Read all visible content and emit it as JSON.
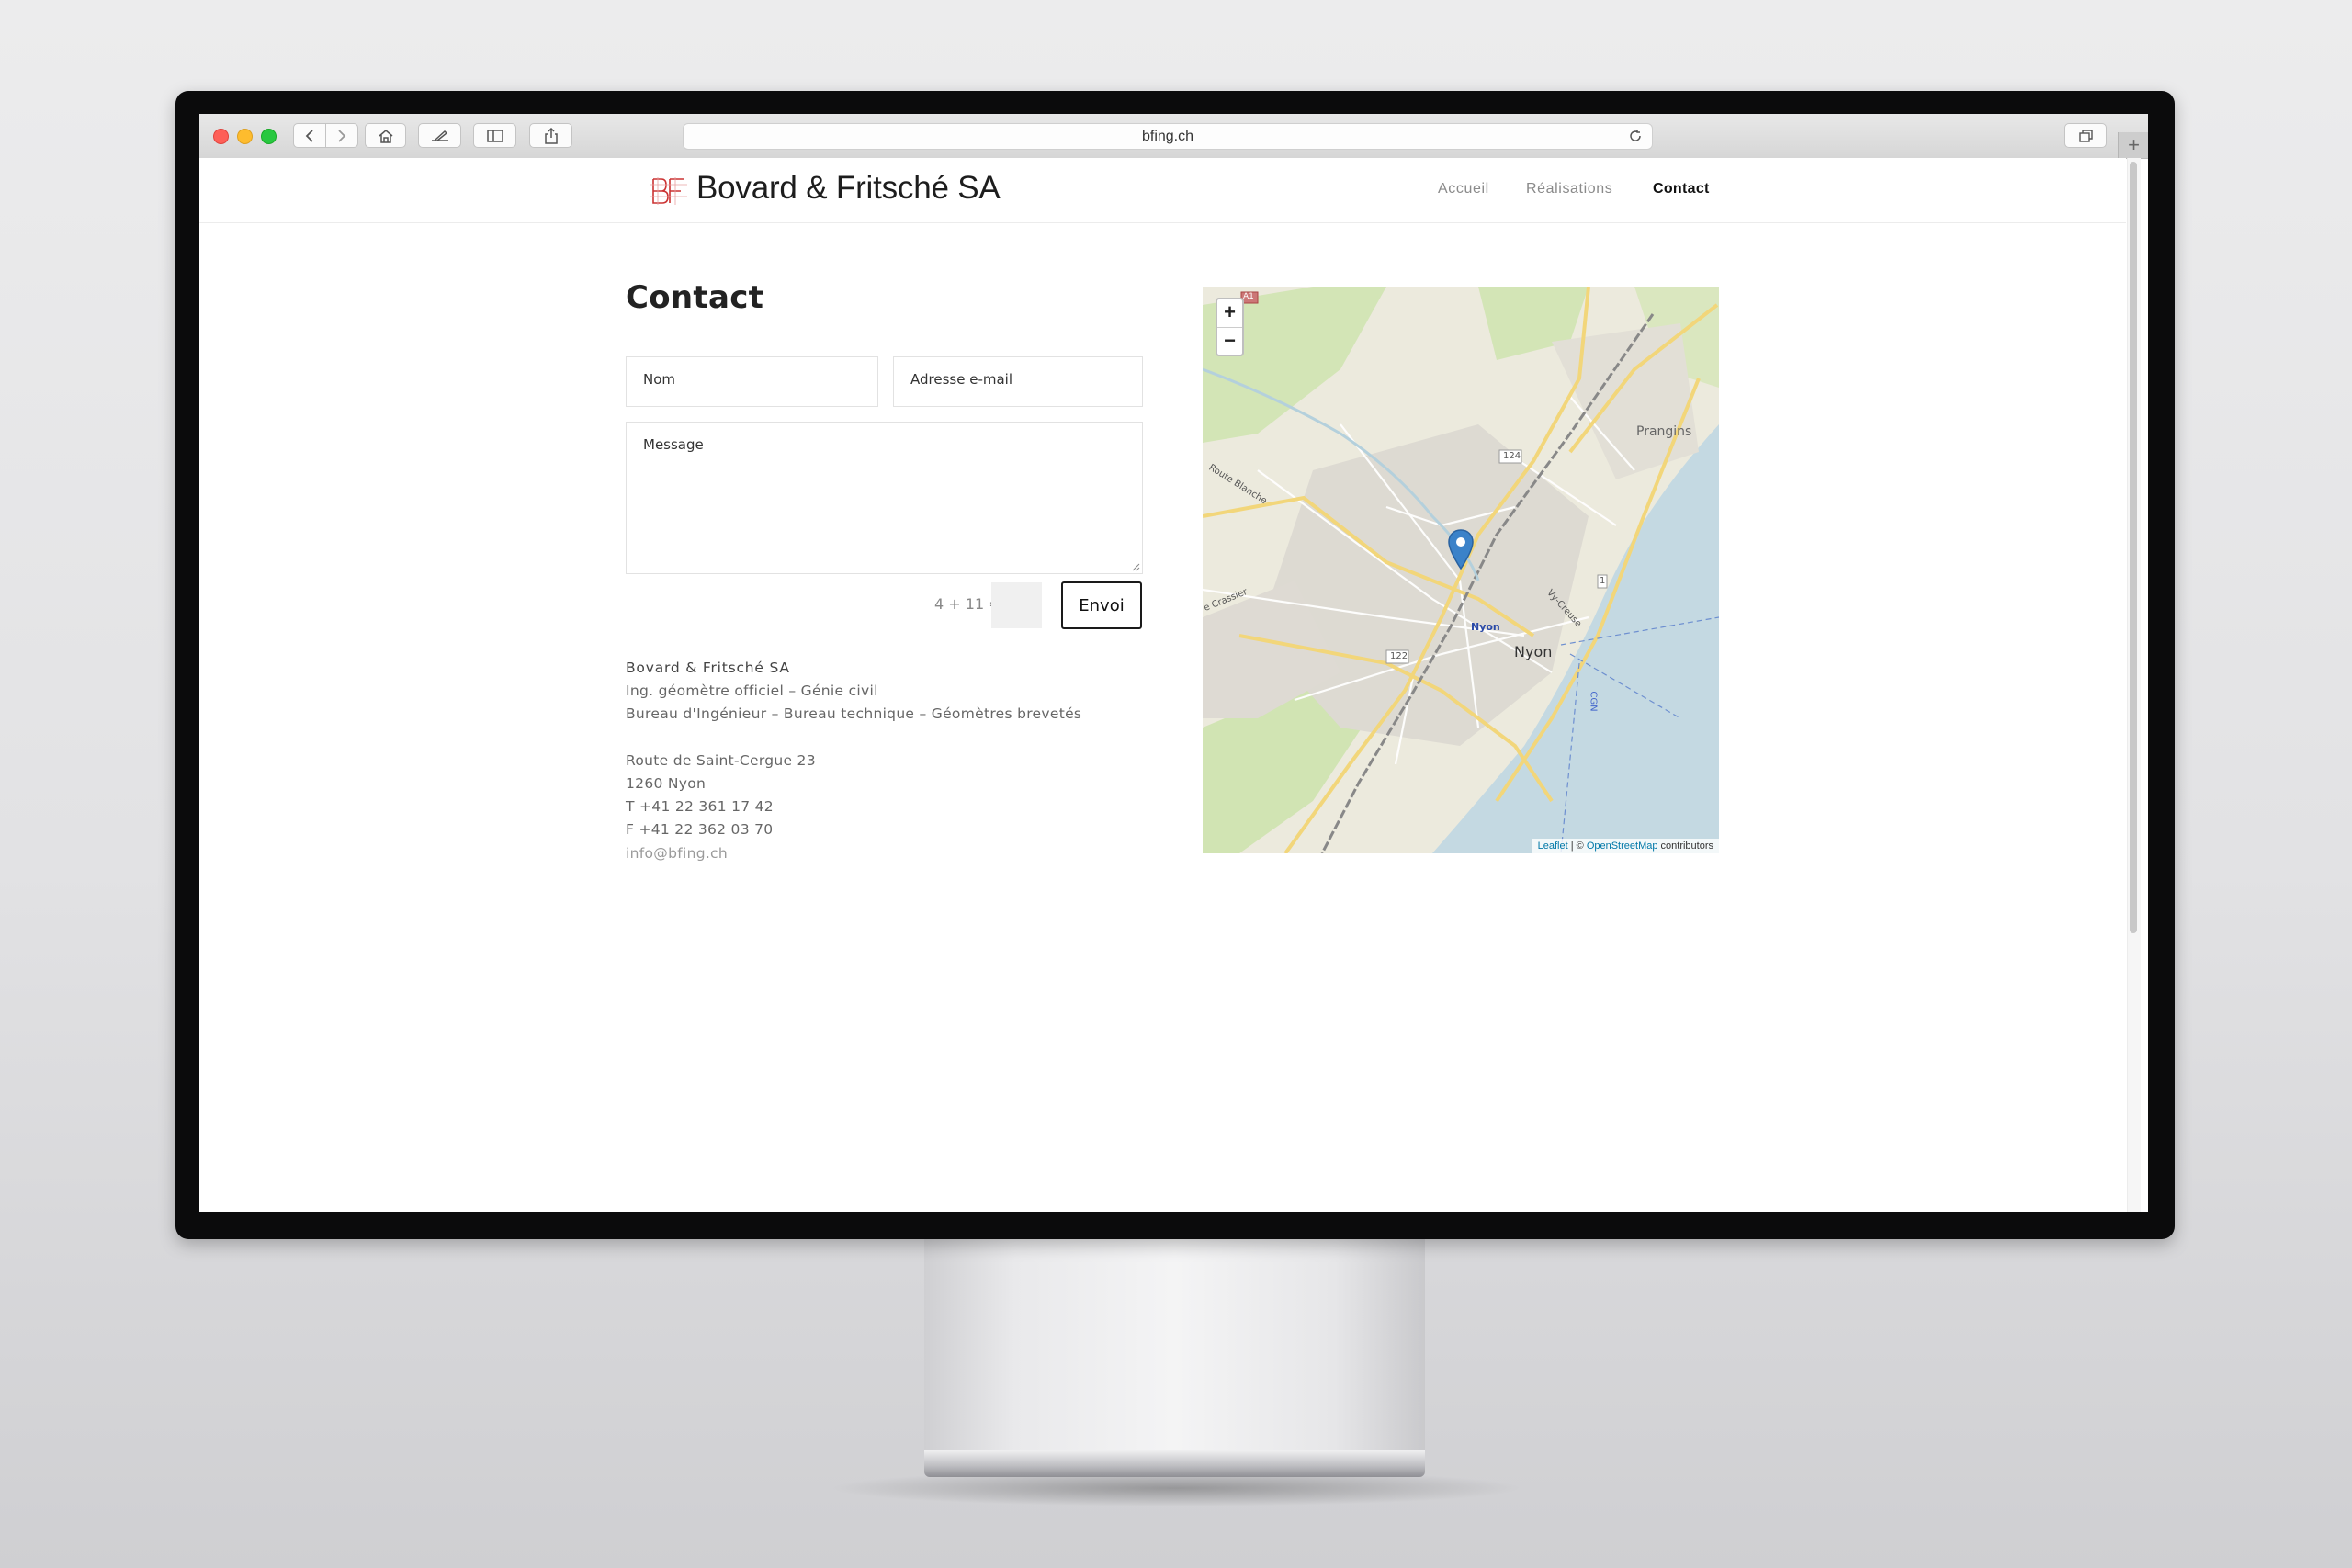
{
  "browser": {
    "url": "bfing.ch"
  },
  "site": {
    "logo_text": "Bovard & Fritsché SA",
    "nav": [
      {
        "label": "Accueil",
        "active": false
      },
      {
        "label": "Réalisations",
        "active": false
      },
      {
        "label": "Contact",
        "active": true
      }
    ]
  },
  "contact": {
    "title": "Contact",
    "form": {
      "name_placeholder": "Nom",
      "email_placeholder": "Adresse e-mail",
      "message_placeholder": "Message",
      "captcha_question": "4 + 11 =",
      "captcha_value": "",
      "send_label": "Envoi"
    },
    "company": {
      "name": "Bovard & Fritsché SA",
      "line1": "Ing. géomètre officiel – Génie civil",
      "line2": "Bureau d'Ingénieur – Bureau technique – Géomètres brevetés",
      "street": "Route de Saint-Cergue 23",
      "city": "1260 Nyon",
      "phone": "T +41 22 361 17 42",
      "fax": "F +41 22 362 03 70",
      "email": "info@bfing.ch"
    }
  },
  "map": {
    "zoom_in": "+",
    "zoom_out": "−",
    "attribution_leaflet": "Leaflet",
    "attribution_sep": " | © ",
    "attribution_osm": "OpenStreetMap",
    "attribution_tail": " contributors",
    "labels": {
      "nyon": "Nyon",
      "nyon_station": "Nyon",
      "prangins": "Prangins",
      "route_blanche": "Route Blanche",
      "crassier": "e Crassier",
      "vy_creuse": "Vy-Creuse",
      "road_124": "124",
      "road_122": "122",
      "road_1": "1",
      "road_a1": "A1",
      "cgn": "CGN"
    },
    "colors": {
      "water": "#c4d9e2",
      "land": "#eceadd",
      "green": "#cde3ac",
      "urban": "#dcdcdc",
      "road": "#f7e6a0",
      "marker": "#3b82c9"
    }
  }
}
